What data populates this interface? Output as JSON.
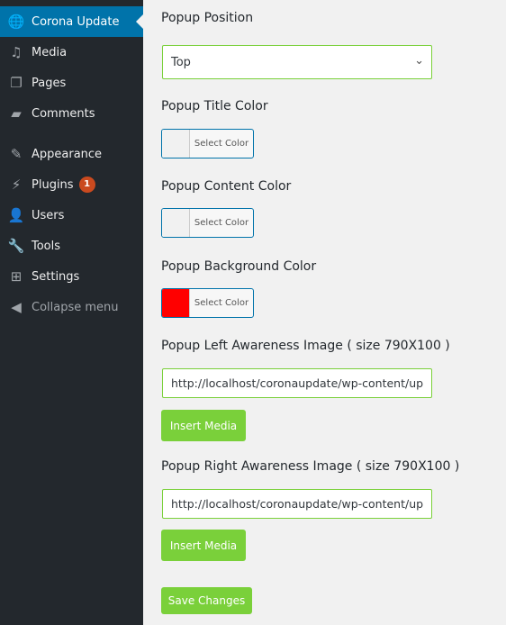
{
  "sidebar": {
    "items": [
      {
        "label": "Corona Update",
        "icon": "globe-icon"
      },
      {
        "label": "Media",
        "icon": "media-icon"
      },
      {
        "label": "Pages",
        "icon": "pages-icon"
      },
      {
        "label": "Comments",
        "icon": "comment-icon"
      },
      {
        "label": "Appearance",
        "icon": "paintbrush-icon"
      },
      {
        "label": "Plugins",
        "icon": "plugin-icon",
        "badge": "1"
      },
      {
        "label": "Users",
        "icon": "user-icon"
      },
      {
        "label": "Tools",
        "icon": "wrench-icon"
      },
      {
        "label": "Settings",
        "icon": "settings-icon"
      },
      {
        "label": "Collapse menu",
        "icon": "collapse-icon"
      }
    ]
  },
  "form": {
    "position_label": "Popup Position",
    "position_value": "Top",
    "title_color_label": "Popup Title Color",
    "content_color_label": "Popup Content Color",
    "bg_color_label": "Popup Background Color",
    "bg_color_value": "#ff0000",
    "select_color": "Select Color",
    "left_image_label": "Popup Left Awareness Image ( size 790X100 )",
    "left_image_value": "http://localhost/coronaupdate/wp-content/up",
    "right_image_label": "Popup Right Awareness Image ( size 790X100 )",
    "right_image_value": "http://localhost/coronaupdate/wp-content/up",
    "insert_media": "Insert Media",
    "save": "Save Changes"
  },
  "colors": {
    "accent": "#0073aa",
    "button": "#7ad03a",
    "sidebar": "#23282d"
  }
}
